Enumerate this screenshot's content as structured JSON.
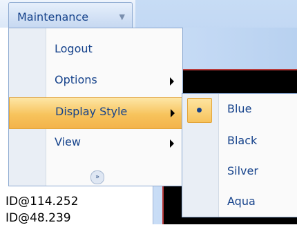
{
  "menubar": {
    "title": "Maintenance"
  },
  "menu": {
    "items": [
      {
        "label": "Logout",
        "has_submenu": false
      },
      {
        "label": "Options",
        "has_submenu": true
      },
      {
        "label": "Display Style",
        "has_submenu": true,
        "highlighted": true
      },
      {
        "label": "View",
        "has_submenu": true
      }
    ]
  },
  "submenu": {
    "items": [
      {
        "label": "Blue",
        "selected": true
      },
      {
        "label": "Black",
        "selected": false
      },
      {
        "label": "Silver",
        "selected": false
      },
      {
        "label": "Aqua",
        "selected": false
      }
    ]
  },
  "background": {
    "lines": [
      "ID@114.252",
      "ID@48.239"
    ]
  },
  "colors": {
    "accent": "#f7c35c",
    "text": "#15428b",
    "border": "#8ba8d0"
  }
}
